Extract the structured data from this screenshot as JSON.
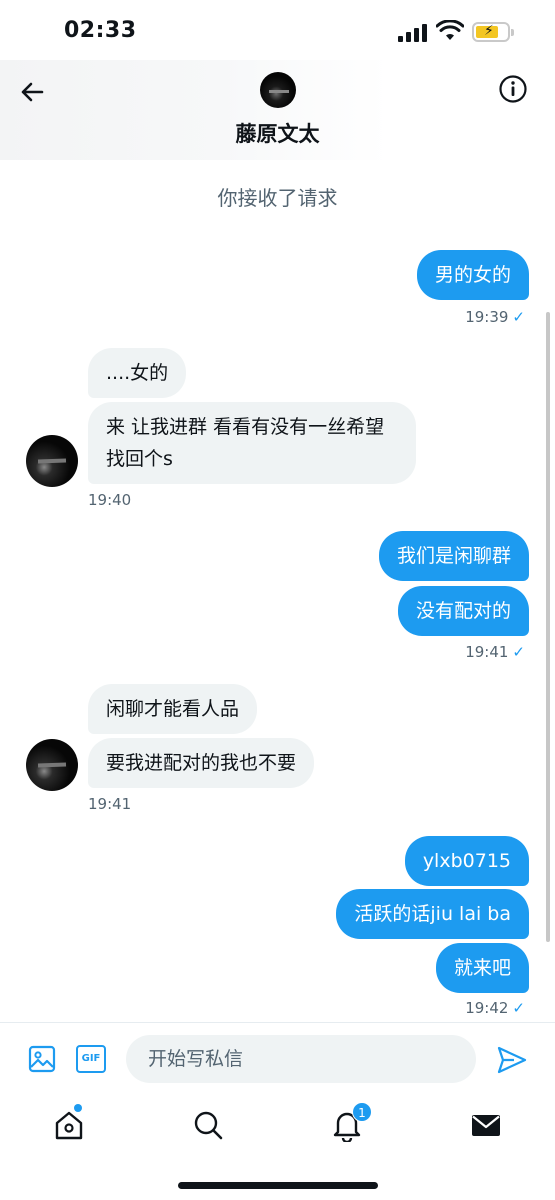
{
  "status_bar": {
    "time": "02:33",
    "battery_color": "#f3c623"
  },
  "header": {
    "contact_name": "藤原文太",
    "back_icon": "arrow-left-icon",
    "info_icon": "info-icon"
  },
  "request_note": "你接收了请求",
  "messages": [
    {
      "direction": "out",
      "text": "男的女的"
    },
    {
      "direction": "meta",
      "time": "19:39",
      "read_mark": "✓"
    },
    {
      "direction": "in",
      "text": "....女的"
    },
    {
      "direction": "in",
      "text": "来 让我进群 看看有没有一丝希望找回个s"
    },
    {
      "direction": "meta",
      "time": "19:40"
    },
    {
      "direction": "out",
      "text": "我们是闲聊群"
    },
    {
      "direction": "out",
      "text": "没有配对的"
    },
    {
      "direction": "meta",
      "time": "19:41",
      "read_mark": "✓"
    },
    {
      "direction": "in",
      "text": "闲聊才能看人品"
    },
    {
      "direction": "in",
      "text": "要我进配对的我也不要"
    },
    {
      "direction": "meta",
      "time": "19:41"
    },
    {
      "direction": "out",
      "text": "ylxb0715"
    },
    {
      "direction": "out",
      "text": "活跃的话jiu lai ba"
    },
    {
      "direction": "out",
      "text": "就来吧"
    },
    {
      "direction": "meta",
      "time": "19:42",
      "read_mark": "✓"
    }
  ],
  "composer": {
    "placeholder": "开始写私信",
    "gif_label": "GIF",
    "icons": [
      "image-icon",
      "gif-icon",
      "send-icon"
    ]
  },
  "bottom_nav": {
    "items": [
      "home-icon",
      "search-icon",
      "bell-icon",
      "mail-icon"
    ],
    "notification_count": "1"
  },
  "colors": {
    "accent": "#1d9bf0",
    "incoming_bubble": "#eff3f4",
    "muted_text": "#536471"
  }
}
